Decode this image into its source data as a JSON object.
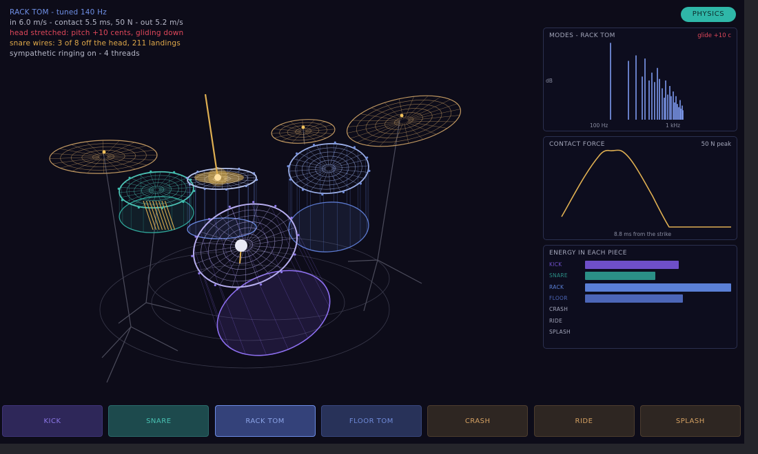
{
  "readout": {
    "line1": "RACK TOM  -  tuned 140 Hz",
    "line2": "in 6.0 m/s  -  contact 5.5 ms, 50 N  -  out 5.2 m/s",
    "line3": "head stretched: pitch +10 cents, gliding down",
    "line4": "snare wires: 3 of 8 off the head, 211 landings",
    "line5": "sympathetic ringing on  -  4 threads"
  },
  "physics_button": "PHYSICS",
  "modes": {
    "title": "MODES - RACK TOM",
    "glide": "glide +10 c",
    "ylabel": "dB",
    "tick_100": "100 Hz",
    "tick_1k": "1 kHz",
    "levels": [
      0.98,
      0.75,
      0.82,
      0.55,
      0.78,
      0.5,
      0.6,
      0.48,
      0.66,
      0.52,
      0.4,
      0.28,
      0.5,
      0.32,
      0.43,
      0.3,
      0.36,
      0.22,
      0.3,
      0.2,
      0.16,
      0.25,
      0.14,
      0.18,
      0.12
    ]
  },
  "contact": {
    "title": "CONTACT FORCE",
    "peak": "50 N peak",
    "caption": "8.8 ms from the strike"
  },
  "energy": {
    "title": "ENERGY IN EACH PIECE",
    "items": [
      {
        "label": "KICK",
        "level": 0.64,
        "color": "#6e4fc8"
      },
      {
        "label": "SNARE",
        "level": 0.48,
        "color": "#2b8f86"
      },
      {
        "label": "RACK",
        "level": 1.0,
        "color": "#5a7fd6"
      },
      {
        "label": "FLOOR",
        "level": 0.67,
        "color": "#4c66b8"
      },
      {
        "label": "CRASH",
        "level": 0,
        "color": "#c9a46a"
      },
      {
        "label": "RIDE",
        "level": 0,
        "color": "#c9a46a"
      },
      {
        "label": "SPLASH",
        "level": 0,
        "color": "#c9a46a"
      }
    ]
  },
  "pads": [
    {
      "label": "KICK",
      "bg": "#2e2759",
      "fg": "#8d78e8",
      "border": "#3f3478"
    },
    {
      "label": "SNARE",
      "bg": "#1d4a4d",
      "fg": "#49c2b3",
      "border": "#2a6b6b"
    },
    {
      "label": "RACK TOM",
      "bg": "#34427a",
      "fg": "#8ba3e6",
      "border": "#6d8de6"
    },
    {
      "label": "FLOOR TOM",
      "bg": "#283259",
      "fg": "#6f8ad8",
      "border": "#39477e"
    },
    {
      "label": "CRASH",
      "bg": "#2e2622",
      "fg": "#d4a062",
      "border": "#4d3d2e"
    },
    {
      "label": "RIDE",
      "bg": "#2e2622",
      "fg": "#d4a062",
      "border": "#4d3d2e"
    },
    {
      "label": "SPLASH",
      "bg": "#2e2622",
      "fg": "#d4a062",
      "border": "#4d3d2e"
    }
  ]
}
